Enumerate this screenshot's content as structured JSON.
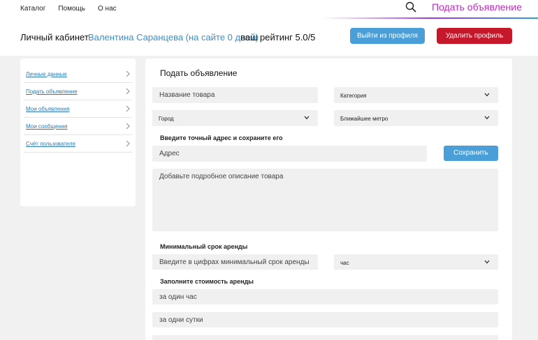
{
  "nav": {
    "items": [
      "Каталог",
      "Помощь",
      "О нас"
    ],
    "post_ad": "Подать объявление"
  },
  "header": {
    "title": "Личный кабинет",
    "user": "Валентина Саранцева (на сайте 0 дней)",
    "rating": "ваш рейтинг 5.0/5",
    "logout": "Выйти из профиля",
    "delete": "Удалить профиль"
  },
  "sidebar": {
    "items": [
      "Личные данные",
      "Подать объявление",
      "Мои объявления",
      "Мои сообщения",
      "Счёт пользователя"
    ]
  },
  "form": {
    "title": "Подать объявление",
    "product_name_placeholder": "Название товара",
    "category": "Категория",
    "city": "Город",
    "metro": "Ближайшее метро",
    "address_label": "Введите точный адрес и сохраните его",
    "address_placeholder": "Адрес",
    "save": "Сохранить",
    "description_placeholder": "Добавьте подробное описание товара",
    "min_term_label": "Минимальный срок аренды",
    "min_term_placeholder": "Введите в цифрах минимальный срок аренды",
    "term_unit": "час",
    "price_label": "Заполните стоимость аренды",
    "price_hour": "за один час",
    "price_day": "за одни сутки"
  },
  "colors": {
    "accent_blue": "#4a9fd8",
    "delete_red": "#c5182a",
    "post_link": "#c327c6",
    "user_blue": "#3a8fc7"
  },
  "icons": {
    "search": "search-icon",
    "chevron": "chevron-right-icon",
    "dropdown": "chevron-down-icon"
  }
}
